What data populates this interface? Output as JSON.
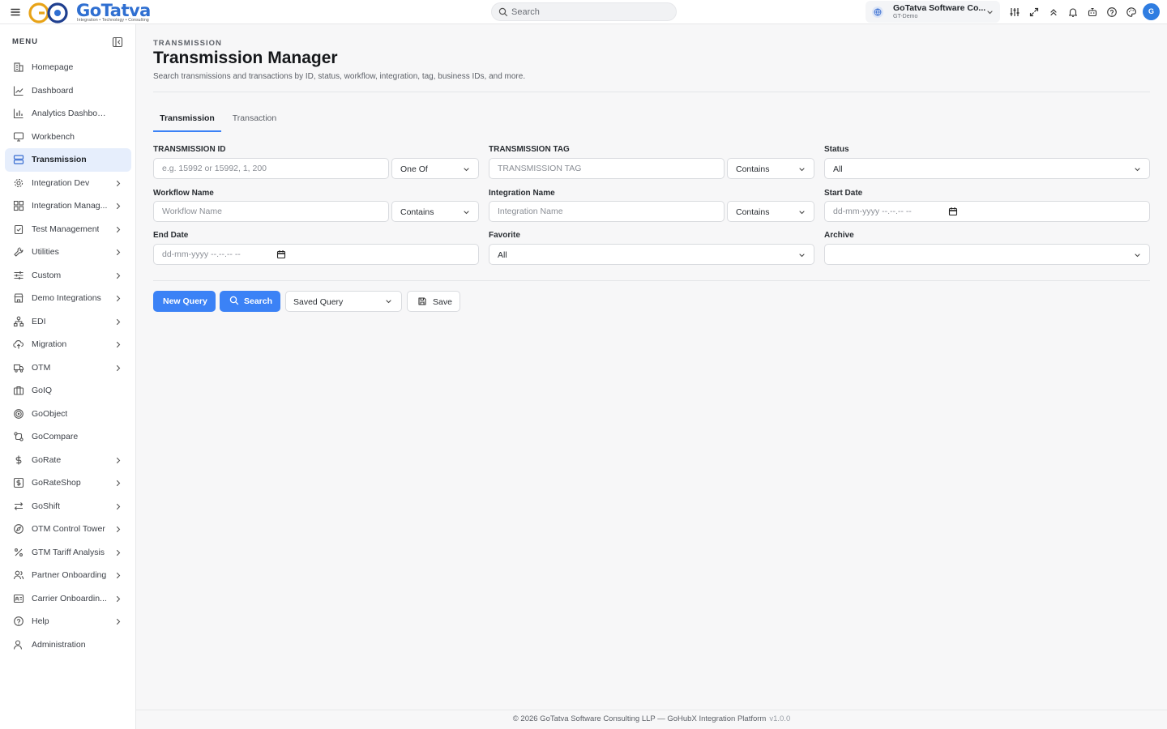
{
  "topbar": {
    "logo_text": "GoTatva",
    "logo_tagline": "Integration • Technology • Consulting",
    "search_placeholder": "Search",
    "org_name": "GoTatva Software Co...",
    "org_sub": "GT-Demo",
    "avatar_initial": "G",
    "icons": [
      "sliders-icon",
      "expand-icon",
      "chevrons-up-icon",
      "bell-icon",
      "robot-icon",
      "help-icon",
      "palette-icon"
    ]
  },
  "sidebar": {
    "title": "MENU",
    "items": [
      {
        "label": "Homepage",
        "icon": "building-icon",
        "has_children": false,
        "active": false
      },
      {
        "label": "Dashboard",
        "icon": "line-chart-icon",
        "has_children": false,
        "active": false
      },
      {
        "label": "Analytics Dashboard",
        "icon": "bar-chart-icon",
        "has_children": false,
        "active": false
      },
      {
        "label": "Workbench",
        "icon": "monitor-icon",
        "has_children": false,
        "active": false
      },
      {
        "label": "Transmission",
        "icon": "server-icon",
        "has_children": false,
        "active": true
      },
      {
        "label": "Integration Dev",
        "icon": "gear-icon",
        "has_children": true,
        "active": false
      },
      {
        "label": "Integration Manag...",
        "icon": "grid-icon",
        "has_children": true,
        "active": false
      },
      {
        "label": "Test Management",
        "icon": "clipboard-check-icon",
        "has_children": true,
        "active": false
      },
      {
        "label": "Utilities",
        "icon": "wrench-icon",
        "has_children": true,
        "active": false
      },
      {
        "label": "Custom",
        "icon": "sliders-horizontal-icon",
        "has_children": true,
        "active": false
      },
      {
        "label": "Demo Integrations",
        "icon": "store-icon",
        "has_children": true,
        "active": false
      },
      {
        "label": "EDI",
        "icon": "network-icon",
        "has_children": true,
        "active": false
      },
      {
        "label": "Migration",
        "icon": "cloud-upload-icon",
        "has_children": true,
        "active": false
      },
      {
        "label": "OTM",
        "icon": "truck-icon",
        "has_children": true,
        "active": false
      },
      {
        "label": "GoIQ",
        "icon": "briefcase-icon",
        "has_children": false,
        "active": false
      },
      {
        "label": "GoObject",
        "icon": "target-icon",
        "has_children": false,
        "active": false
      },
      {
        "label": "GoCompare",
        "icon": "git-compare-icon",
        "has_children": false,
        "active": false
      },
      {
        "label": "GoRate",
        "icon": "dollar-icon",
        "has_children": true,
        "active": false
      },
      {
        "label": "GoRateShop",
        "icon": "dollar-square-icon",
        "has_children": true,
        "active": false
      },
      {
        "label": "GoShift",
        "icon": "arrows-swap-icon",
        "has_children": true,
        "active": false
      },
      {
        "label": "OTM Control Tower",
        "icon": "compass-icon",
        "has_children": true,
        "active": false
      },
      {
        "label": "GTM Tariff Analysis",
        "icon": "percent-icon",
        "has_children": true,
        "active": false
      },
      {
        "label": "Partner Onboarding",
        "icon": "users-icon",
        "has_children": true,
        "active": false
      },
      {
        "label": "Carrier Onboardin...",
        "icon": "id-card-icon",
        "has_children": true,
        "active": false
      },
      {
        "label": "Help",
        "icon": "help-circle-icon",
        "has_children": true,
        "active": false
      },
      {
        "label": "Administration",
        "icon": "user-cog-icon",
        "has_children": false,
        "active": false
      }
    ]
  },
  "page": {
    "breadcrumb": "TRANSMISSION",
    "title": "Transmission Manager",
    "description": "Search transmissions and transactions by ID, status, workflow, integration, tag, business IDs, and more."
  },
  "tabs": [
    {
      "label": "Transmission",
      "active": true
    },
    {
      "label": "Transaction",
      "active": false
    }
  ],
  "form": {
    "transmission_id": {
      "label": "TRANSMISSION ID",
      "placeholder": "e.g. 15992 or 15992, 1, 200",
      "operator": "One Of"
    },
    "transmission_tag": {
      "label": "TRANSMISSION TAG",
      "placeholder": "TRANSMISSION TAG",
      "operator": "Contains"
    },
    "status": {
      "label": "Status",
      "value": "All"
    },
    "workflow_name": {
      "label": "Workflow Name",
      "placeholder": "Workflow Name",
      "operator": "Contains"
    },
    "integration_name": {
      "label": "Integration Name",
      "placeholder": "Integration Name",
      "operator": "Contains"
    },
    "start_date": {
      "label": "Start Date",
      "placeholder": "dd-mm-yyyy --.--.-- --"
    },
    "end_date": {
      "label": "End Date",
      "placeholder": "dd-mm-yyyy --.--.-- --"
    },
    "favorite": {
      "label": "Favorite",
      "value": "All"
    },
    "archive": {
      "label": "Archive",
      "value": ""
    }
  },
  "actions": {
    "new_query": "New Query",
    "search": "Search",
    "saved_query": "Saved Query",
    "save": "Save"
  },
  "footer": {
    "text": "© 2026 GoTatva Software Consulting LLP — GoHubX Integration Platform",
    "version": "v1.0.0"
  },
  "colors": {
    "accent": "#3b82f6",
    "active_bg": "#e6eefc",
    "brand": "#2f6fd1"
  }
}
